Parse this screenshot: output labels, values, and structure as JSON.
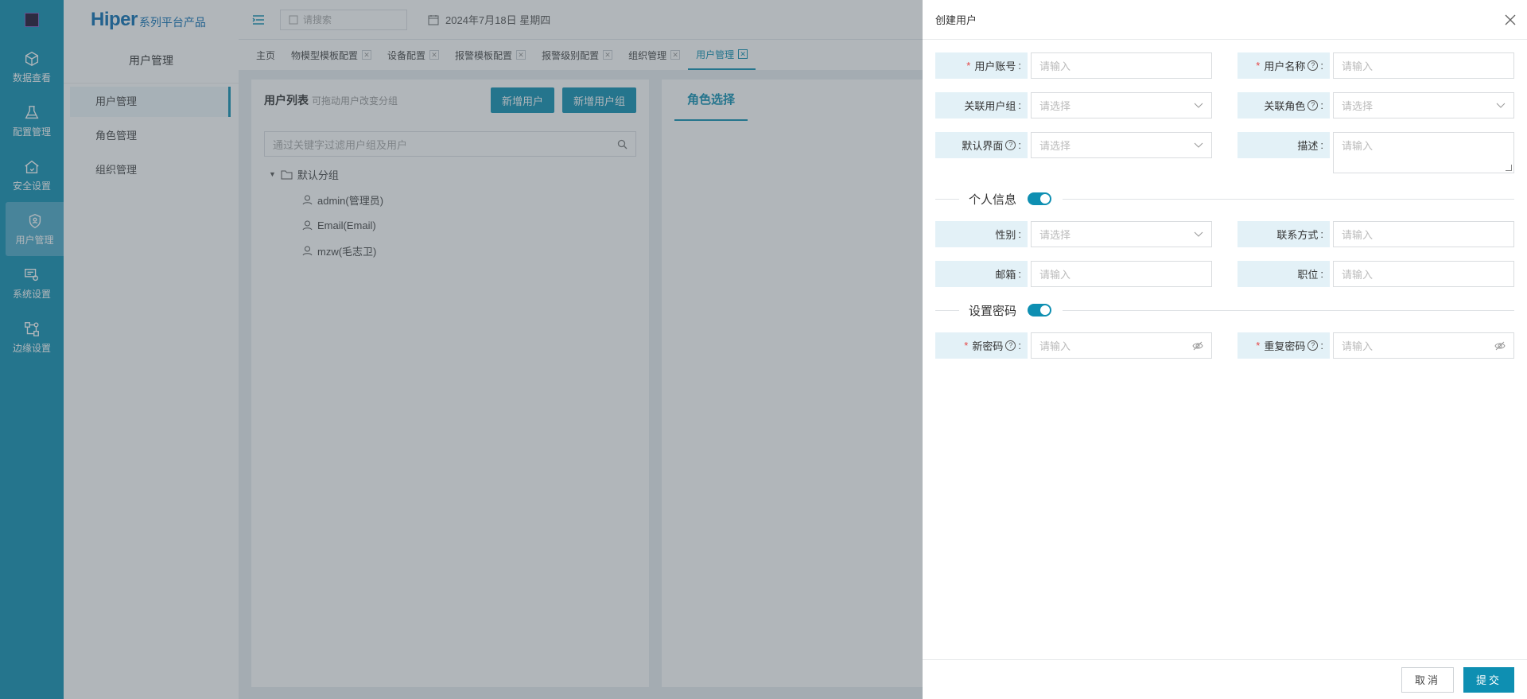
{
  "rail": {
    "items": [
      {
        "label": "数据查看"
      },
      {
        "label": "配置管理"
      },
      {
        "label": "安全设置"
      },
      {
        "label": "用户管理"
      },
      {
        "label": "系统设置"
      },
      {
        "label": "边缘设置"
      }
    ]
  },
  "brand": {
    "big": "Hiper",
    "small": "系列平台产品"
  },
  "submenu": {
    "title": "用户管理",
    "items": [
      {
        "label": "用户管理"
      },
      {
        "label": "角色管理"
      },
      {
        "label": "组织管理"
      }
    ]
  },
  "topbar": {
    "search_placeholder": "请搜索",
    "date": "2024年7月18日 星期四"
  },
  "tabs": [
    {
      "label": "主页"
    },
    {
      "label": "物模型模板配置"
    },
    {
      "label": "设备配置"
    },
    {
      "label": "报警模板配置"
    },
    {
      "label": "报警级别配置"
    },
    {
      "label": "组织管理"
    },
    {
      "label": "用户管理"
    }
  ],
  "user_list": {
    "title": "用户列表",
    "hint": "可拖动用户改变分组",
    "add_user": "新增用户",
    "add_group": "新增用户组",
    "filter_placeholder": "通过关键字过滤用户组及用户",
    "group": "默认分组",
    "users": [
      "admin(管理员)",
      "Email(Email)",
      "mzw(毛志卫)"
    ]
  },
  "role_panel": {
    "tab": "角色选择"
  },
  "drawer": {
    "title": "创建用户",
    "account": {
      "label": "用户账号",
      "placeholder": "请输入"
    },
    "name": {
      "label": "用户名称",
      "placeholder": "请输入"
    },
    "user_group": {
      "label": "关联用户组",
      "placeholder": "请选择"
    },
    "role": {
      "label": "关联角色",
      "placeholder": "请选择"
    },
    "default_view": {
      "label": "默认界面",
      "placeholder": "请选择"
    },
    "description": {
      "label": "描述",
      "placeholder": "请输入"
    },
    "personal_section": "个人信息",
    "gender": {
      "label": "性别",
      "placeholder": "请选择"
    },
    "contact": {
      "label": "联系方式",
      "placeholder": "请输入"
    },
    "email": {
      "label": "邮箱",
      "placeholder": "请输入"
    },
    "position": {
      "label": "职位",
      "placeholder": "请输入"
    },
    "password_section": "设置密码",
    "new_password": {
      "label": "新密码",
      "placeholder": "请输入"
    },
    "repeat_password": {
      "label": "重复密码",
      "placeholder": "请输入"
    },
    "colon": ":",
    "q": "?",
    "req": "*",
    "cancel": "取消",
    "submit": "提交"
  }
}
